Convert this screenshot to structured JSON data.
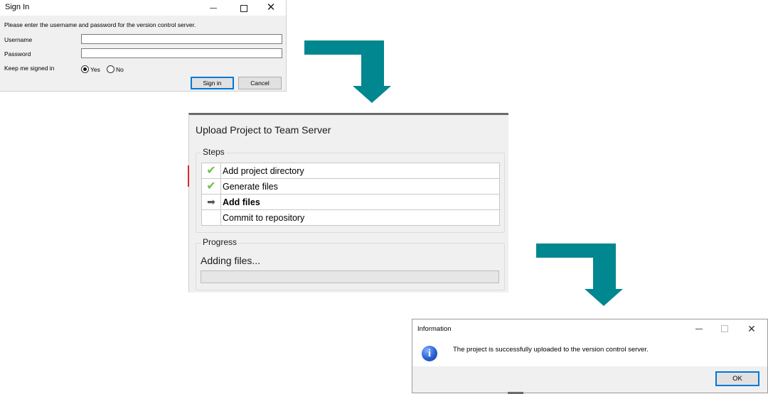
{
  "signin": {
    "title": "Sign In",
    "instruction": "Please enter the username and password for the version control server.",
    "username_label": "Username",
    "username_value": "",
    "password_label": "Password",
    "password_value": "",
    "keep_label": "Keep me signed in",
    "keep_options": [
      {
        "label": "Yes",
        "selected": true
      },
      {
        "label": "No",
        "selected": false
      }
    ],
    "signin_button": "Sign in",
    "cancel_button": "Cancel"
  },
  "upload": {
    "title": "Upload Project to Team Server",
    "steps_label": "Steps",
    "steps": [
      {
        "label": "Add project directory",
        "status": "done",
        "icon": "check-icon"
      },
      {
        "label": "Generate files",
        "status": "done",
        "icon": "check-icon"
      },
      {
        "label": "Add files",
        "status": "current",
        "icon": "arrow-right-icon"
      },
      {
        "label": "Commit to repository",
        "status": "pending",
        "icon": ""
      }
    ],
    "progress_label": "Progress",
    "progress_text": "Adding files...",
    "progress_fraction": 0
  },
  "info": {
    "title": "Information",
    "message": "The project is successfully uploaded to the version control server.",
    "ok_button": "OK",
    "icon": "info-icon"
  },
  "colors": {
    "flow_arrow": "#00878f",
    "check": "#6cc24a",
    "accent": "#0078d7"
  }
}
